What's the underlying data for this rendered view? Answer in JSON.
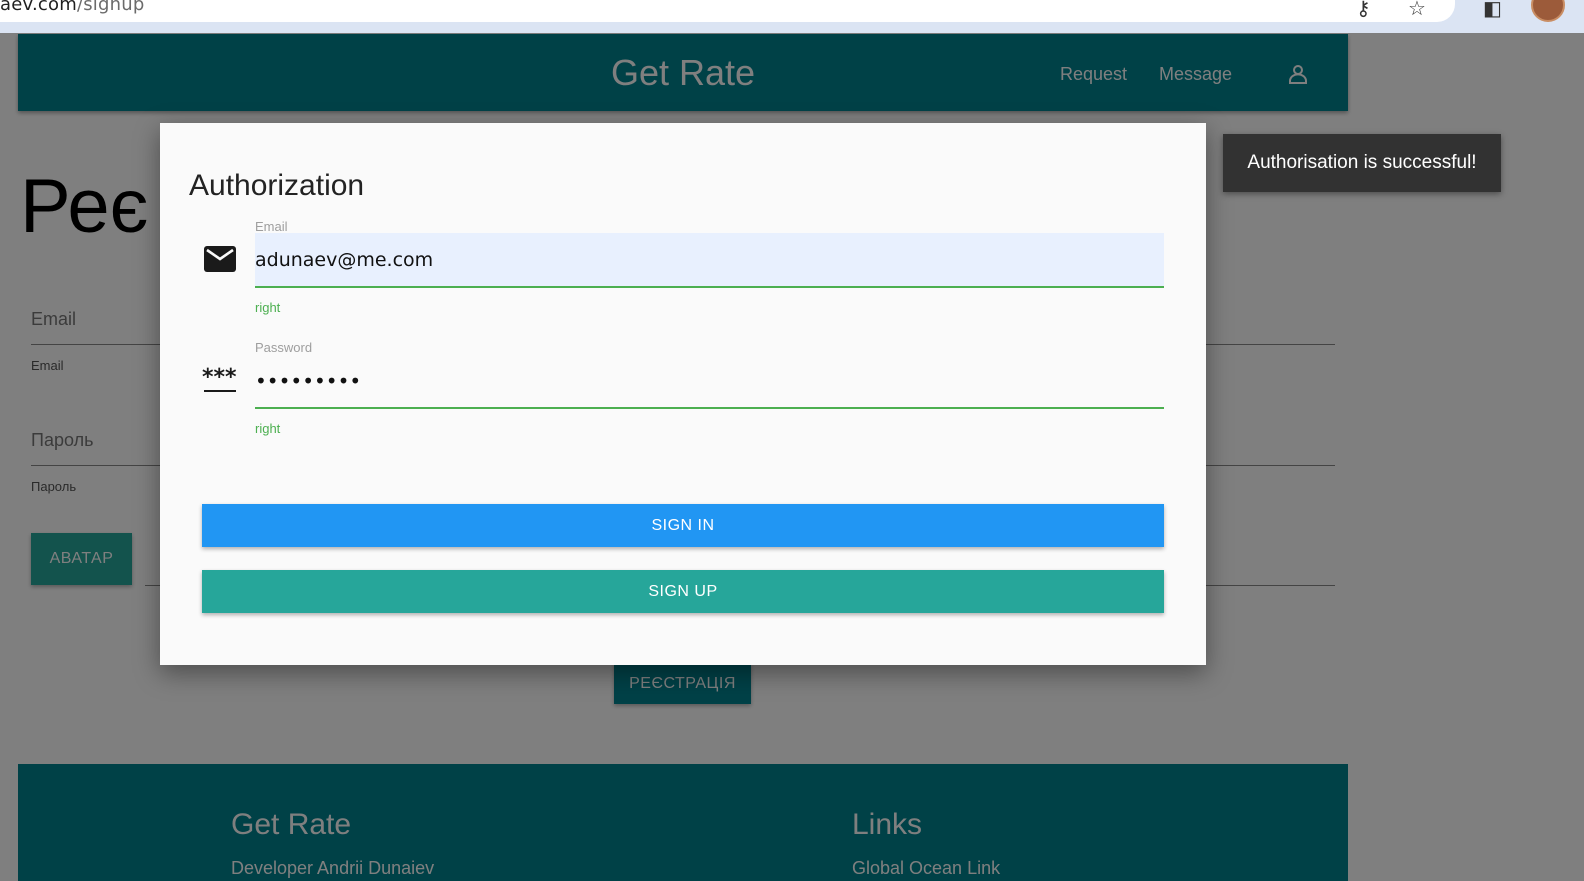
{
  "browser": {
    "url_host": "aev.com",
    "url_path": "/signup"
  },
  "navbar": {
    "brand": "Get Rate",
    "links": [
      "Request",
      "Message"
    ],
    "user_icon": "person-icon"
  },
  "background_form": {
    "heading": "Реє",
    "email_placeholder": "Email",
    "email_helper": "Email",
    "password_placeholder": "Пароль",
    "password_helper": "Пароль",
    "avatar_button": "АВАТАР",
    "register_button": "РЕЄСТРАЦІЯ"
  },
  "footer": {
    "col1_title": "Get Rate",
    "col1_text": "Developer Andrii Dunaiev",
    "col2_title": "Links",
    "col2_text": "Global Ocean Link"
  },
  "modal": {
    "title": "Authorization",
    "email": {
      "label": "Email",
      "value": "adunaev@me.com",
      "helper": "right",
      "icon": "mail-icon"
    },
    "password": {
      "label": "Password",
      "value": "•••••••••",
      "helper": "right",
      "icon": "password-icon"
    },
    "sign_in_label": "SIGN IN",
    "sign_up_label": "SIGN UP"
  },
  "toast": {
    "message": "Authorisation is successful!"
  },
  "colors": {
    "primary": "#00838f",
    "teal_button": "#26a69a",
    "blue_button": "#2196f3",
    "valid": "#4caf50",
    "toast_bg": "#323232"
  }
}
